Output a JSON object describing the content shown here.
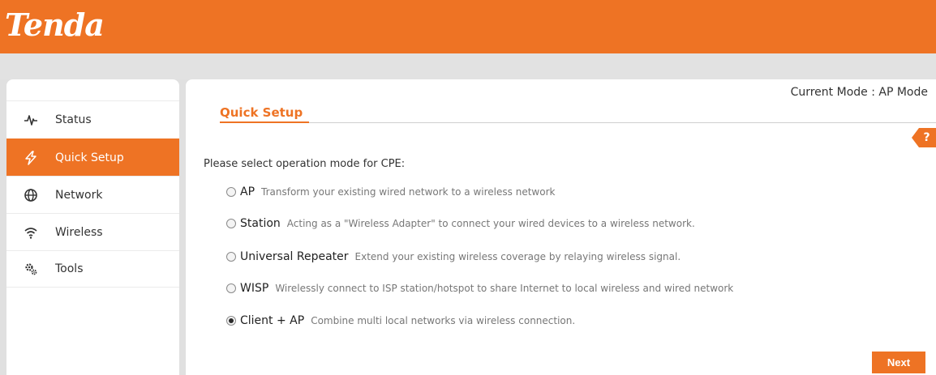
{
  "brand": {
    "logo_text": "Tenda",
    "accent_color": "#ee7324"
  },
  "sidebar": {
    "items": [
      {
        "label": "Status",
        "icon": "pulse-icon",
        "active": false
      },
      {
        "label": "Quick Setup",
        "icon": "lightning-icon",
        "active": true
      },
      {
        "label": "Network",
        "icon": "globe-icon",
        "active": false
      },
      {
        "label": "Wireless",
        "icon": "wifi-icon",
        "active": false
      },
      {
        "label": "Tools",
        "icon": "gears-icon",
        "active": false
      }
    ]
  },
  "main": {
    "current_mode": "Current Mode : AP Mode",
    "title": "Quick Setup",
    "help_label": "?",
    "prompt": "Please select operation mode for CPE:",
    "options": [
      {
        "label": "AP",
        "description": "Transform your existing wired network to a wireless network",
        "selected": false
      },
      {
        "label": "Station",
        "description": "Acting as a \"Wireless Adapter\" to connect your wired devices to a wireless network.",
        "selected": false
      },
      {
        "label": "Universal Repeater",
        "description": "Extend your existing wireless coverage by relaying wireless signal.",
        "selected": false
      },
      {
        "label": "WISP",
        "description": "Wirelessly connect to ISP station/hotspot to share Internet to local wireless and wired network",
        "selected": false
      },
      {
        "label": "Client + AP",
        "description": "Combine multi local networks via wireless connection.",
        "selected": true
      }
    ],
    "next_label": "Next"
  }
}
